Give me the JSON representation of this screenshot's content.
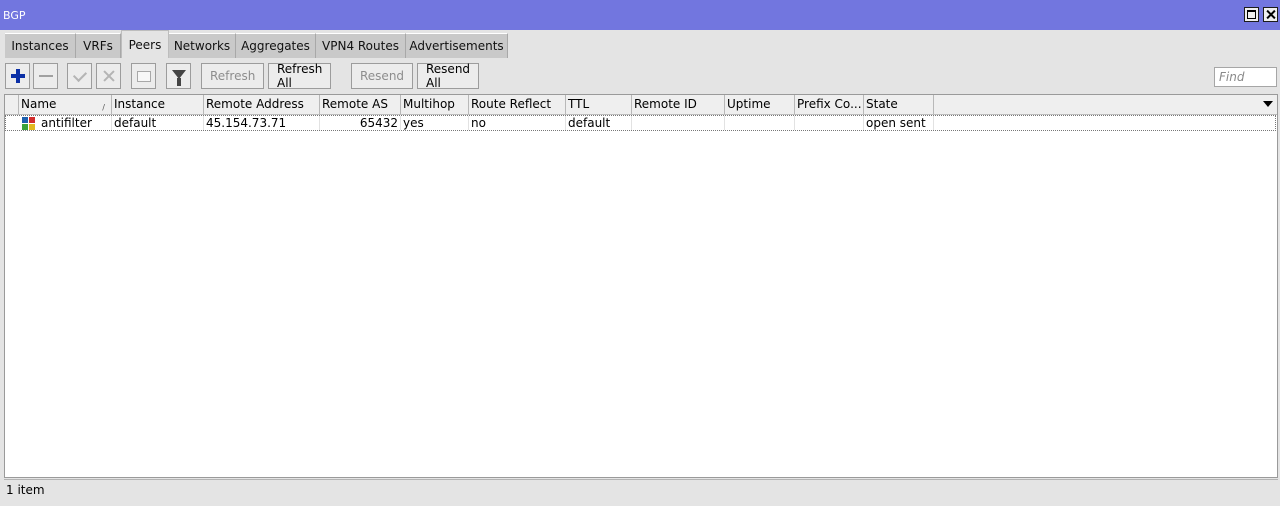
{
  "window": {
    "title": "BGP"
  },
  "tabs": [
    {
      "label": "Instances"
    },
    {
      "label": "VRFs"
    },
    {
      "label": "Peers",
      "active": true
    },
    {
      "label": "Networks"
    },
    {
      "label": "Aggregates"
    },
    {
      "label": "VPN4 Routes"
    },
    {
      "label": "Advertisements"
    }
  ],
  "toolbar": {
    "icons": [
      "plus-icon",
      "minus-icon",
      "check-icon",
      "x-icon",
      "comment-icon",
      "filter-icon"
    ],
    "refresh_label": "Refresh",
    "refresh_all_label": "Refresh All",
    "resend_label": "Resend",
    "resend_all_label": "Resend All",
    "find_placeholder": "Find",
    "find_value": ""
  },
  "table": {
    "columns": [
      "Name",
      "Instance",
      "Remote Address",
      "Remote AS",
      "Multihop",
      "Route Reflect",
      "TTL",
      "Remote ID",
      "Uptime",
      "Prefix Co...",
      "State"
    ],
    "sort_indicator": "/",
    "rows": [
      {
        "name": "antifilter",
        "instance": "default",
        "remote_address": "45.154.73.71",
        "remote_as": "65432",
        "multihop": "yes",
        "route_reflect": "no",
        "ttl": "default",
        "remote_id": "",
        "uptime": "",
        "prefix_count": "",
        "state": "open sent"
      }
    ]
  },
  "status": {
    "count_text": "1 item"
  },
  "colors": {
    "titlebar": "#7276df",
    "add_icon": "#0b2fa6"
  }
}
